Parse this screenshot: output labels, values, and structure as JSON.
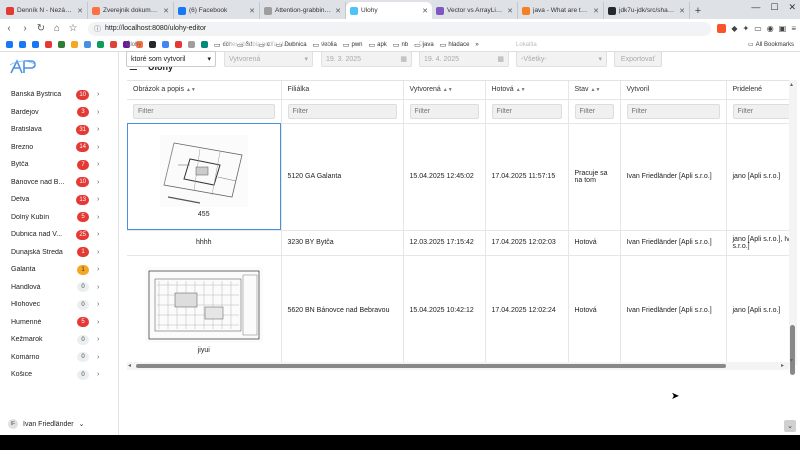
{
  "browser": {
    "tabs": [
      {
        "title": "Denník N - Nezávislý d",
        "color": "#e53935",
        "active": false
      },
      {
        "title": "Zverejnik dokumenty o",
        "color": "#ff7043",
        "active": false
      },
      {
        "title": "(6) Facebook",
        "color": "#1877f2",
        "active": false
      },
      {
        "title": "Attention-grabbing tec",
        "color": "#9e9e9e",
        "active": false
      },
      {
        "title": "Úlohy",
        "color": "#4fc3f7",
        "active": true
      },
      {
        "title": "Vector vs ArrayList in Ja",
        "color": "#7e57c2",
        "active": false
      },
      {
        "title": "java - What are the diffe",
        "color": "#f48024",
        "active": false
      },
      {
        "title": "jdk7u-jdk/src/share/cla",
        "color": "#24292e",
        "active": false
      }
    ],
    "url": "http://localhost:8080/ulohy-editor",
    "bookmarks": [
      "cor",
      "3d",
      "c",
      "Dubnica",
      "veolia",
      "pwn",
      "apk",
      "nb",
      "java",
      "hladace"
    ],
    "all_bookmarks": "All Bookmarks"
  },
  "app": {
    "title": "Úlohy",
    "user": "Ivan Friedländer",
    "user_initials": "IF",
    "cities": [
      {
        "name": "Banská Bystrica",
        "count": "10",
        "type": "red"
      },
      {
        "name": "Bardejov",
        "count": "3",
        "type": "red"
      },
      {
        "name": "Bratislava",
        "count": "31",
        "type": "red"
      },
      {
        "name": "Brezno",
        "count": "14",
        "type": "red"
      },
      {
        "name": "Bytča",
        "count": "7",
        "type": "red"
      },
      {
        "name": "Bánovce nad B...",
        "count": "10",
        "type": "red"
      },
      {
        "name": "Detva",
        "count": "13",
        "type": "red"
      },
      {
        "name": "Dolný Kubín",
        "count": "5",
        "type": "red"
      },
      {
        "name": "Dubnica nad V...",
        "count": "25",
        "type": "red"
      },
      {
        "name": "Dunajská Streda",
        "count": "1",
        "type": "red"
      },
      {
        "name": "Galanta",
        "count": "1",
        "type": "orange"
      },
      {
        "name": "Handlová",
        "count": "0",
        "type": "zero"
      },
      {
        "name": "Hlohovec",
        "count": "0",
        "type": "zero"
      },
      {
        "name": "Humenné",
        "count": "5",
        "type": "red"
      },
      {
        "name": "Kežmarok",
        "count": "0",
        "type": "zero"
      },
      {
        "name": "Komárno",
        "count": "0",
        "type": "zero"
      },
      {
        "name": "Košice",
        "count": "0",
        "type": "zero"
      }
    ],
    "filters": {
      "uloh_label": "Úlohy",
      "uloh_value": "ktoré som vytvoril",
      "stav_label": "Filter obdobia podľa stavu",
      "stav_value": "Vytvorená",
      "od_label": "Od",
      "od_value": "19. 3. 2025",
      "do_label": "Do",
      "do_value": "19. 4. 2025",
      "lokalita_label": "Lokalita",
      "lokalita_value": "-Všetky-",
      "export_label": "Exportovať"
    },
    "grid": {
      "columns": [
        "Obrázok a popis",
        "Filiálka",
        "Vytvorená",
        "Hotová",
        "Stav",
        "Vytvoril",
        "Pridelené"
      ],
      "sortable": [
        true,
        false,
        true,
        true,
        true,
        false,
        false
      ],
      "filter_placeholder": "Filter",
      "rows": [
        {
          "caption": "455",
          "filialka": "5120 GA Galanta",
          "vytvorena": "15.04.2025 12:45:02",
          "hotova": "17.04.2025 11:57:15",
          "stav": "Pracuje sa na tom",
          "vytvoril": "Ivan Friedländer [Apli s.r.o.]",
          "pridelene": "jano [Apli s.r.o.]"
        },
        {
          "caption": "hhhh",
          "filialka": "3230 BY Bytča",
          "vytvorena": "12.03.2025 17:15:42",
          "hotova": "17.04.2025 12:02:03",
          "stav": "Hotová",
          "vytvoril": "Ivan Friedländer [Apli s.r.o.]",
          "pridelene": "jano [Apli s.r.o.], Ivan Friedländer [Apli s.r.o.]"
        },
        {
          "caption": "jiyui",
          "filialka": "5620 BN Bánovce nad Bebravou",
          "vytvorena": "15.04.2025 10:42:12",
          "hotova": "17.04.2025 12:02:24",
          "stav": "Hotová",
          "vytvoril": "Ivan Friedländer [Apli s.r.o.]",
          "pridelene": "jano [Apli s.r.o.]"
        }
      ]
    }
  }
}
